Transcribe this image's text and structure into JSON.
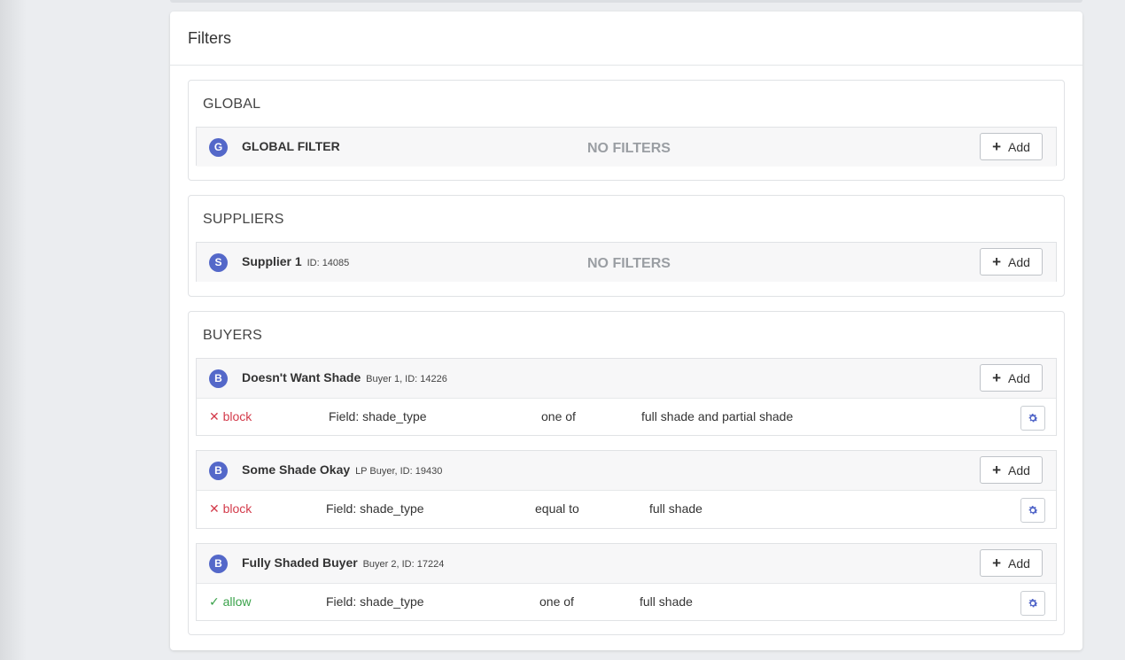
{
  "card": {
    "title": "Filters"
  },
  "global": {
    "title": "GLOBAL",
    "entity": {
      "badge": "G",
      "name": "GLOBAL FILTER",
      "status": "NO FILTERS",
      "add_label": "Add"
    }
  },
  "suppliers": {
    "title": "SUPPLIERS",
    "entity": {
      "badge": "S",
      "name": "Supplier 1",
      "sub": "ID: 14085",
      "status": "NO FILTERS",
      "add_label": "Add"
    }
  },
  "buyers": {
    "title": "BUYERS",
    "items": [
      {
        "badge": "B",
        "name": "Doesn't Want Shade",
        "sub": "Buyer 1, ID: 14226",
        "add_label": "Add",
        "rule": {
          "action_icon": "✕",
          "action": "block",
          "field": "Field: shade_type",
          "operator": "one of",
          "value": "full shade and partial shade"
        }
      },
      {
        "badge": "B",
        "name": "Some Shade Okay",
        "sub": "LP Buyer, ID: 19430",
        "add_label": "Add",
        "rule": {
          "action_icon": "✕",
          "action": "block",
          "field": "Field: shade_type",
          "operator": "equal to",
          "value": "full shade"
        }
      },
      {
        "badge": "B",
        "name": "Fully Shaded Buyer",
        "sub": "Buyer 2, ID: 17224",
        "add_label": "Add",
        "rule": {
          "action_icon": "✓",
          "action": "allow",
          "field": "Field: shade_type",
          "operator": "one of",
          "value": "full shade"
        }
      }
    ]
  },
  "colors": {
    "badge": "#5468c9",
    "block": "#d33b4b",
    "allow": "#3aa24a",
    "gear": "#5468c9"
  },
  "icons": {
    "add": "plus-icon",
    "settings": "gear-icon",
    "block": "x-icon",
    "allow": "check-icon"
  }
}
